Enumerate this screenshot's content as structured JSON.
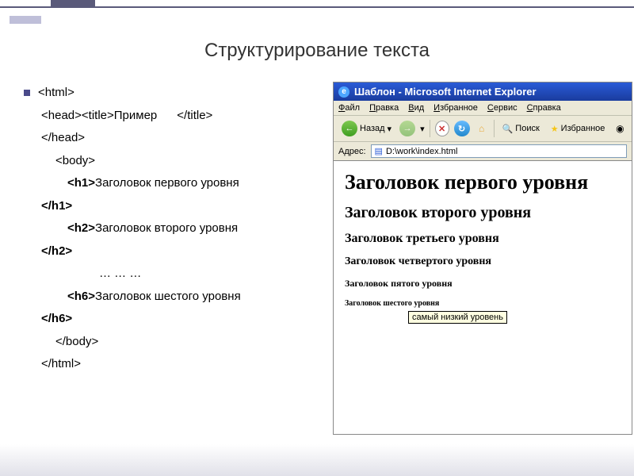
{
  "slide": {
    "title": "Структурирование текста"
  },
  "code": {
    "l1": "<html>",
    "l2a": "<head><title>Пример",
    "l2b": "</title>",
    "l3": "</head>",
    "l4": "<body>",
    "l5a": "<h1>",
    "l5b": "Заголовок первого уровня",
    "l5c": "</h1>",
    "l6a": "<h2>",
    "l6b": "Заголовок второго уровня",
    "l6c": "</h2>",
    "l7": "… … …",
    "l8a": "<h6>",
    "l8b": "Заголовок шестого уровня",
    "l8c": "</h6>",
    "l9": "</body>",
    "l10": "</html>"
  },
  "browser": {
    "title": "Шаблон - Microsoft Internet Explorer",
    "menu": {
      "file": "Файл",
      "edit": "Правка",
      "view": "Вид",
      "favorites": "Избранное",
      "tools": "Сервис",
      "help": "Справка"
    },
    "toolbar": {
      "back": "Назад",
      "search": "Поиск",
      "favs": "Избранное"
    },
    "address": {
      "label": "Адрес:",
      "value": "D:\\work\\index.html"
    },
    "page": {
      "h1": "Заголовок первого уровня",
      "h2": "Заголовок второго уровня",
      "h3": "Заголовок третьего уровня",
      "h4": "Заголовок четвертого уровня",
      "h5": "Заголовок пятого уровня",
      "h6": "Заголовок шестого уровня",
      "tooltip": "самый низкий уровень"
    }
  }
}
